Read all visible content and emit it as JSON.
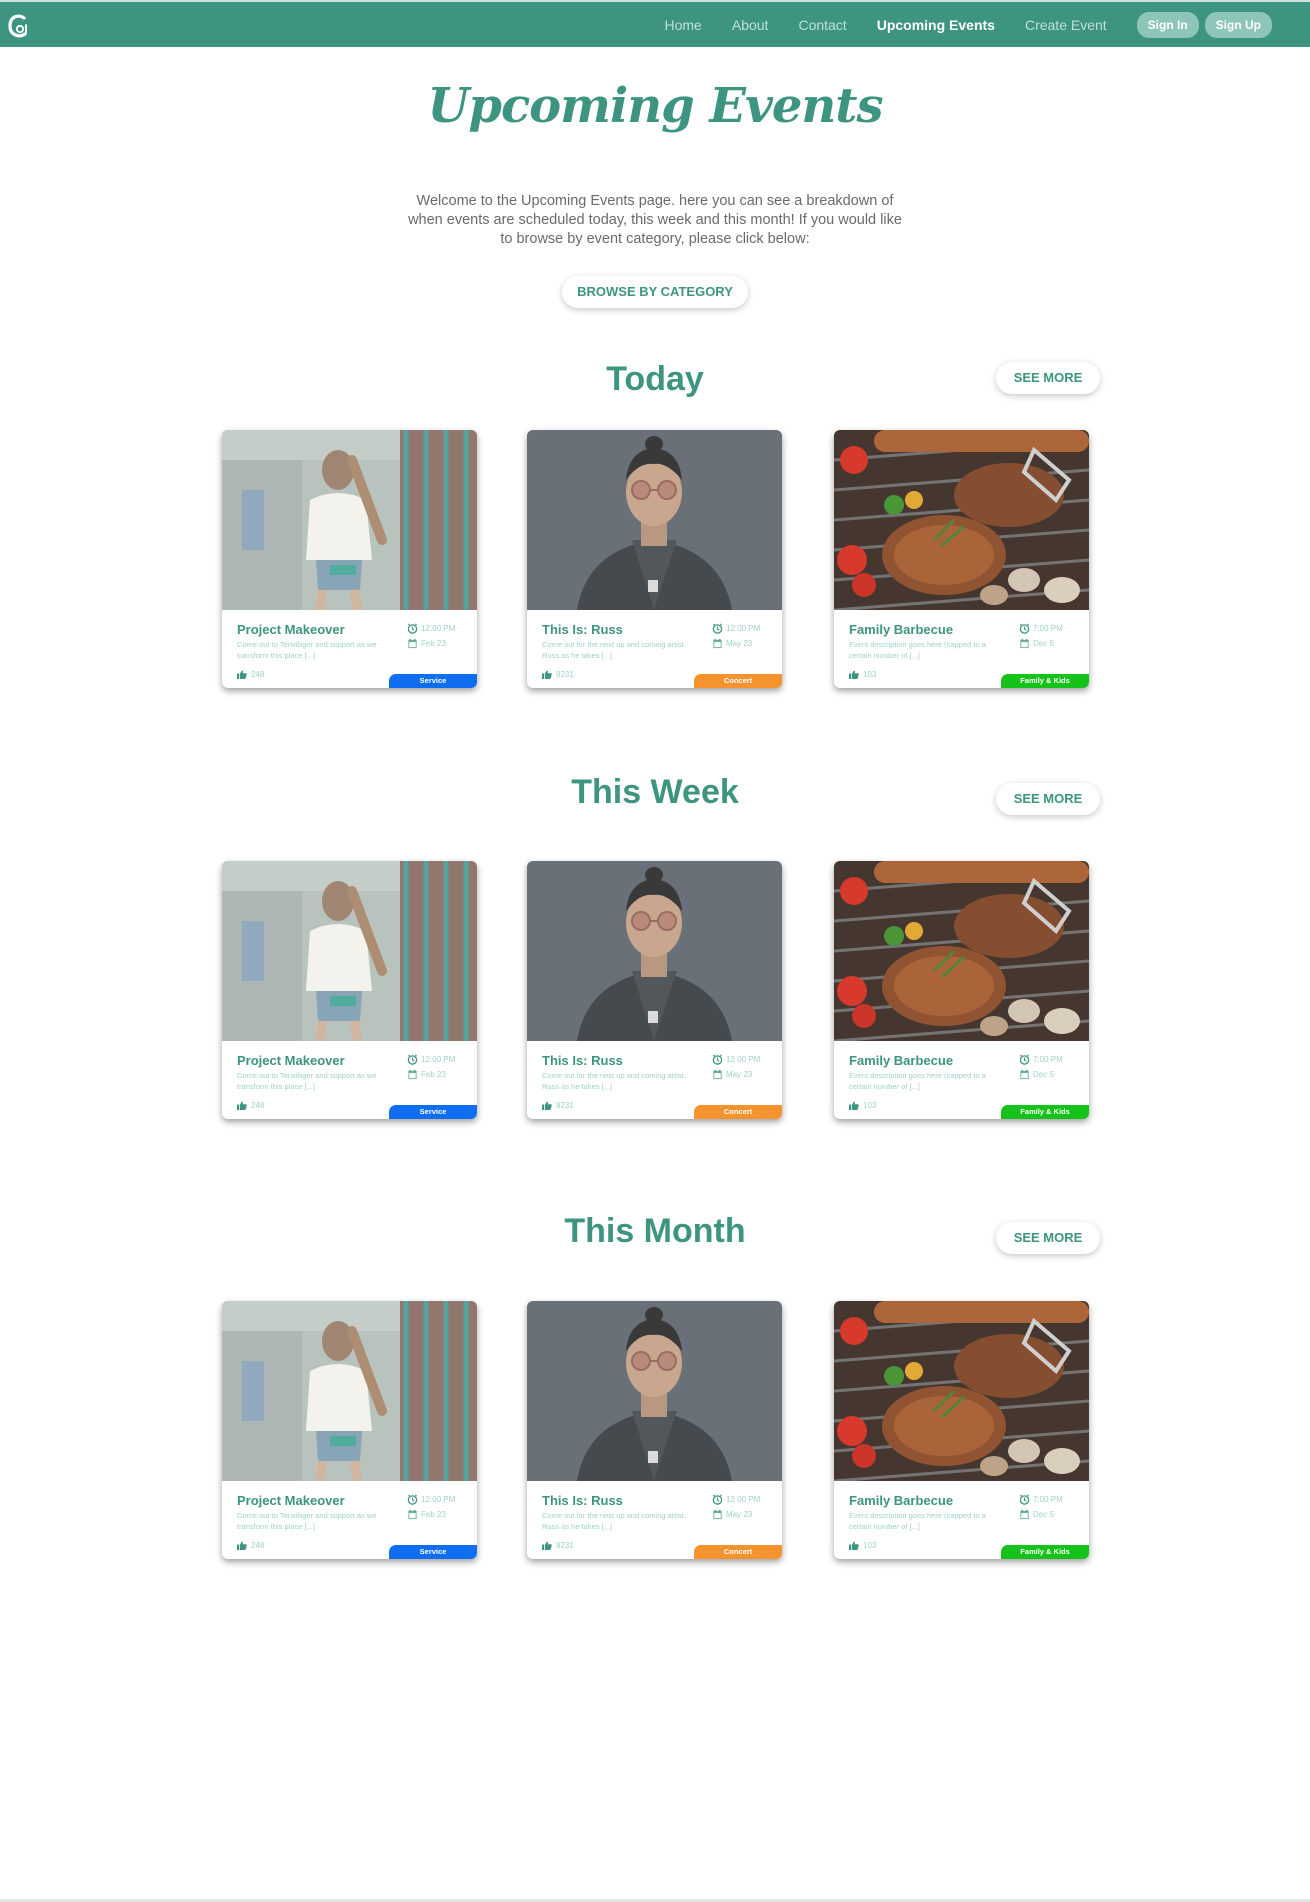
{
  "nav": {
    "links": [
      "Home",
      "About",
      "Contact",
      "Upcoming Events",
      "Create Event"
    ],
    "active_link": "Upcoming Events",
    "sign_in": "Sign In",
    "sign_up": "Sign Up"
  },
  "hero": {
    "title": "Upcoming Events",
    "intro": "Welcome to the Upcoming Events page. here you can see a breakdown of when events are scheduled today, this week and this month! If you would like to browse by event category, please click below:",
    "browse_button": "BROWSE BY CATEGORY"
  },
  "sections": [
    {
      "title": "Today",
      "see_more": "SEE MORE",
      "cards": [
        {
          "title": "Project Makeover",
          "description": "Come out to Terwilliger and support as we transform this place [...]",
          "time": "12:00 PM",
          "date": "Feb 23",
          "likes": "248",
          "category": "Service",
          "image": "volunteer"
        },
        {
          "title": "This Is: Russ",
          "description": "Come out for the next up and coming artist. Russ as he takes [...]",
          "time": "12:00 PM",
          "date": "May 23",
          "likes": "9231",
          "category": "Concert",
          "image": "artist"
        },
        {
          "title": "Family Barbecue",
          "description": "Event description goes here (capped to a certain number of [...]",
          "time": "7:00 PM",
          "date": "Dec 5",
          "likes": "103",
          "category": "Family & Kids",
          "image": "bbq"
        }
      ]
    },
    {
      "title": "This Week",
      "see_more": "SEE MORE",
      "cards": [
        {
          "title": "Project Makeover",
          "description": "Come out to Terwilliger and support as we transform this place [...]",
          "time": "12:00 PM",
          "date": "Feb 23",
          "likes": "248",
          "category": "Service",
          "image": "volunteer"
        },
        {
          "title": "This Is: Russ",
          "description": "Come out for the next up and coming artist. Russ as he takes [...]",
          "time": "12:00 PM",
          "date": "May 23",
          "likes": "9231",
          "category": "Concert",
          "image": "artist"
        },
        {
          "title": "Family Barbecue",
          "description": "Event description goes here (capped to a certain number of [...]",
          "time": "7:00 PM",
          "date": "Dec 5",
          "likes": "103",
          "category": "Family & Kids",
          "image": "bbq"
        }
      ]
    },
    {
      "title": "This Month",
      "see_more": "SEE MORE",
      "cards": [
        {
          "title": "Project Makeover",
          "description": "Come out to Terwilliger and support as we transform this place [...]",
          "time": "12:00 PM",
          "date": "Feb 23",
          "likes": "248",
          "category": "Service",
          "image": "volunteer"
        },
        {
          "title": "This Is: Russ",
          "description": "Come out for the next up and coming artist. Russ as he takes [...]",
          "time": "12:00 PM",
          "date": "May 23",
          "likes": "9231",
          "category": "Concert",
          "image": "artist"
        },
        {
          "title": "Family Barbecue",
          "description": "Event description goes here (capped to a certain number of [...]",
          "time": "7:00 PM",
          "date": "Dec 5",
          "likes": "103",
          "category": "Family & Kids",
          "image": "bbq"
        }
      ]
    }
  ],
  "colors": {
    "brand": "#3d9480",
    "service": "#0f6ef0",
    "concert": "#f5932f",
    "family": "#14c21a"
  }
}
